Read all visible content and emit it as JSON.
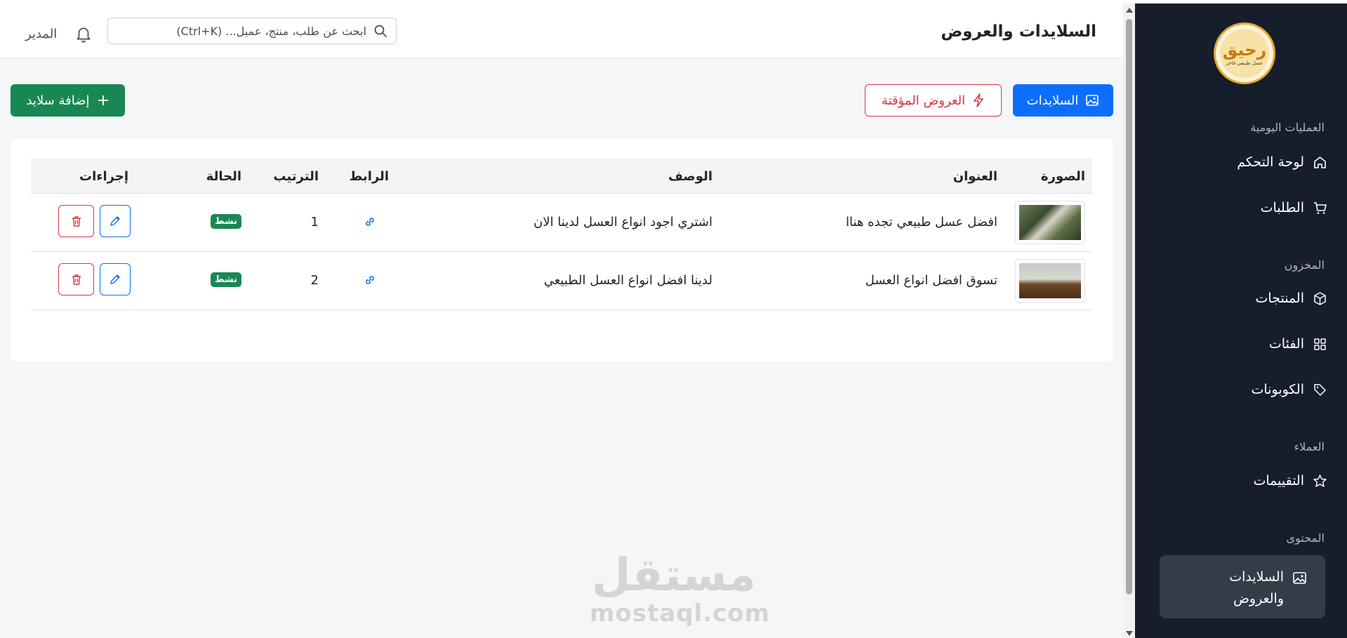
{
  "header": {
    "title": "السلايدات والعروض",
    "search_placeholder": "ابحث عن طلب، منتج، عميل... (Ctrl+K)",
    "user_name": "المدير"
  },
  "sidebar": {
    "logo_mark": "رحيق",
    "logo_sub": "عسل طبيعي فاخر",
    "sections": {
      "daily": "العمليات اليومية",
      "stock": "المخزون",
      "customers": "العملاء",
      "content": "المحتوى"
    },
    "items": {
      "dashboard": "لوحة التحكم",
      "orders": "الطلبات",
      "products": "المنتجات",
      "categories": "الفئات",
      "coupons": "الكوبونات",
      "reviews": "التقييمات",
      "sliders_line1": "السلايدات",
      "sliders_line2": "والعروض"
    }
  },
  "toolbar": {
    "sliders_label": "السلايدات",
    "offers_label": "العروض المؤقتة",
    "add_label": "إضافة سلايد"
  },
  "table": {
    "headers": {
      "image": "الصورة",
      "title": "العنوان",
      "description": "الوصف",
      "link": "الرابط",
      "order": "الترتيب",
      "status": "الحالة",
      "actions": "إجراءات"
    },
    "rows": [
      {
        "title": "افضل عسل طبيعي تجده هنا‎ا",
        "description": "اشتري اجود انواع العسل لدينا الان",
        "order": "1",
        "status": "نشط"
      },
      {
        "title": "تسوق افضل انواع العسل",
        "description": "لدينا افضل انواع العسل الطبيعي",
        "order": "2",
        "status": "نشط"
      }
    ]
  },
  "watermark": {
    "arabic": "مستقل",
    "latin": "mostaql.com"
  },
  "colors": {
    "sidebar_bg": "#161d2b",
    "primary": "#0d6efd",
    "success": "#198754",
    "danger": "#dc3545"
  }
}
